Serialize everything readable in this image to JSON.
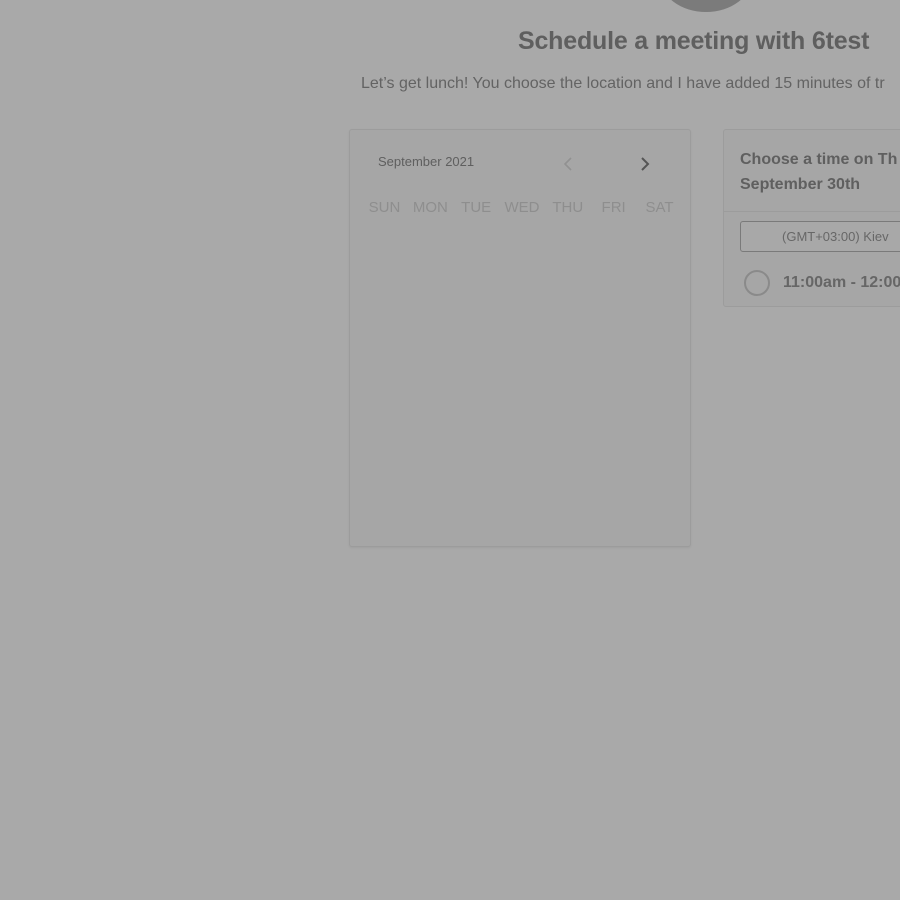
{
  "header": {
    "title": "Schedule a meeting with 6test",
    "subtitle": "Let’s get lunch! You choose the location and I have added 15 minutes of tr"
  },
  "calendar": {
    "month_label": "September 2021",
    "prev_icon": "chevron-left-icon",
    "next_icon": "chevron-right-icon",
    "weekdays": [
      "SUN",
      "MON",
      "TUE",
      "WED",
      "THU",
      "FRI",
      "SAT"
    ]
  },
  "time_picker": {
    "heading_line1": "Choose a time on Th",
    "heading_line2": "September 30th",
    "timezone": "(GMT+03:00) Kiev",
    "slots": [
      {
        "label": "11:00am - 12:00"
      }
    ]
  },
  "colors": {
    "overlay_background": "#a9a9a9",
    "title_text": "#5f5f5f",
    "muted_text": "#8e8e8e"
  }
}
